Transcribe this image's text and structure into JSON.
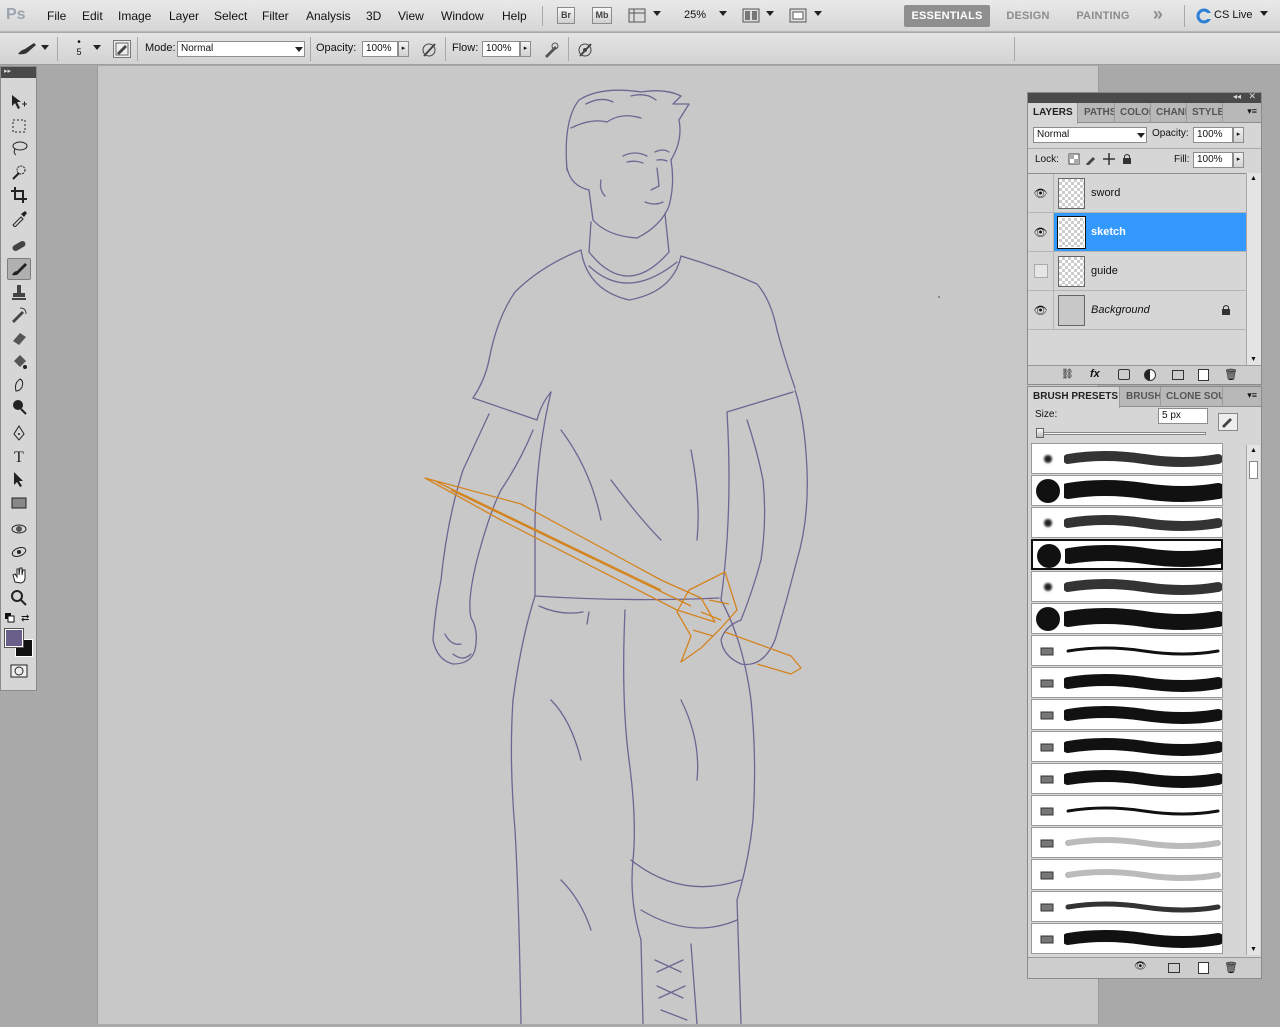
{
  "app": {
    "logo": "Ps",
    "zoom": "25%"
  },
  "menu": [
    "File",
    "Edit",
    "Image",
    "Layer",
    "Select",
    "Filter",
    "Analysis",
    "3D",
    "View",
    "Window",
    "Help"
  ],
  "appbar_icons": {
    "bridge": "Br",
    "mini_bridge": "Mb"
  },
  "workspaces": {
    "essentials": "ESSENTIALS",
    "design": "DESIGN",
    "painting": "PAINTING",
    "more": "»",
    "cslive": "CS Live"
  },
  "options": {
    "brush_size": "5",
    "mode_label": "Mode:",
    "mode_value": "Normal",
    "opacity_label": "Opacity:",
    "opacity_value": "100%",
    "flow_label": "Flow:",
    "flow_value": "100%"
  },
  "tools": [
    "move-tool",
    "marquee-tool",
    "lasso-tool",
    "quick-selection-tool",
    "crop-tool",
    "eyedropper-tool",
    "spot-healing-tool",
    "brush-tool",
    "clone-stamp-tool",
    "history-brush-tool",
    "eraser-tool",
    "paint-bucket-tool",
    "blur-tool",
    "dodge-tool",
    "pen-tool",
    "type-tool",
    "path-selection-tool",
    "rectangle-tool",
    "3d-rotate-tool",
    "3d-orbit-tool",
    "hand-tool",
    "zoom-tool"
  ],
  "colors": {
    "foreground": "#6a5e8a",
    "background": "#111111",
    "sketch_line": "#6e6592",
    "sword_line": "#d4841f",
    "selection": "#3399ff"
  },
  "layers_panel": {
    "tabs": [
      "LAYERS",
      "PATHS",
      "COLOR",
      "CHANNELS",
      "STYLES"
    ],
    "blend_mode": "Normal",
    "opacity_label": "Opacity:",
    "opacity_value": "100%",
    "lock_label": "Lock:",
    "fill_label": "Fill:",
    "fill_value": "100%",
    "layers": [
      {
        "name": "sword",
        "visible": true,
        "selected": false
      },
      {
        "name": "sketch",
        "visible": true,
        "selected": true
      },
      {
        "name": "guide",
        "visible": false,
        "selected": false
      },
      {
        "name": "Background",
        "visible": true,
        "selected": false,
        "locked": true
      }
    ]
  },
  "brush_panel": {
    "tabs": [
      "BRUSH PRESETS",
      "BRUSH",
      "CLONE SOURCE"
    ],
    "size_label": "Size:",
    "size_value": "5 px",
    "size_slider_fraction": 0.0,
    "presets": [
      "soft-round",
      "hard-round",
      "soft-round",
      "hard-round",
      "soft-round",
      "hard-round",
      "airbrush-pen",
      "bristle-flat",
      "bristle-round",
      "bristle-fan",
      "bristle-angle",
      "pencil-point",
      "pencil-blunt",
      "charcoal",
      "crayon",
      "bristle-wide"
    ],
    "selected_preset": 3
  }
}
